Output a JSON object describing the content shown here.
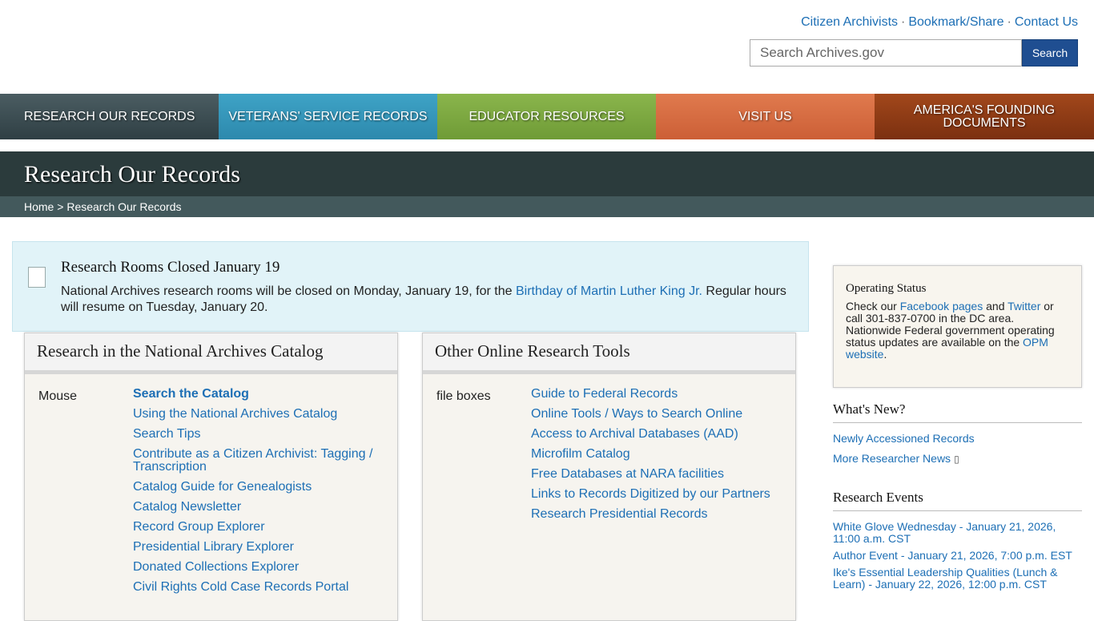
{
  "utility": {
    "citizen": "Citizen Archivists",
    "bookmark": "Bookmark/Share",
    "contact": "Contact Us",
    "separator": "·"
  },
  "search": {
    "placeholder": "Search Archives.gov",
    "button": "Search"
  },
  "nav": [
    {
      "label": "RESEARCH OUR RECORDS"
    },
    {
      "label": "VETERANS' SERVICE RECORDS"
    },
    {
      "label": "EDUCATOR RESOURCES"
    },
    {
      "label": "VISIT US"
    },
    {
      "label": "AMERICA'S FOUNDING DOCUMENTS"
    }
  ],
  "page": {
    "title": "Research Our Records",
    "breadcrumb_home": "Home",
    "breadcrumb_sep": ">",
    "breadcrumb_current": "Research Our Records"
  },
  "alert": {
    "title": "Research Rooms Closed January 19",
    "text_before": "National Archives research rooms will be closed on Monday, January 19, for the ",
    "link": "Birthday of Martin Luther King Jr.",
    "text_after": " Regular hours will resume on Tuesday, January 20."
  },
  "catalog_panel": {
    "title": "Research in the National Archives Catalog",
    "image_alt": "Mouse",
    "links": [
      "Search the Catalog",
      "Using the National Archives Catalog",
      "Search Tips",
      "Contribute as a Citizen Archivist: Tagging / Transcription",
      "Catalog Guide for Genealogists",
      "Catalog Newsletter",
      "Record Group Explorer",
      "Presidential Library Explorer",
      "Donated Collections Explorer",
      "Civil Rights Cold Case Records Portal"
    ]
  },
  "tools_panel": {
    "title": "Other Online Research Tools",
    "image_alt": "file boxes",
    "links": [
      "Guide to Federal Records",
      "Online Tools / Ways to Search Online",
      "Access to Archival Databases (AAD)",
      "Microfilm Catalog",
      "Free Databases at NARA facilities",
      "Links to Records Digitized by our Partners",
      "Research Presidential Records"
    ]
  },
  "sidebar": {
    "operating": {
      "title": "Operating Status",
      "t1": "Check our ",
      "facebook": "Facebook pages",
      "t2": " and ",
      "twitter": "Twitter",
      "t3": " or call 301-837-0700 in the DC area. Nationwide Federal government operating status updates are available on the ",
      "opm": "OPM website",
      "t4": "."
    },
    "whats_new": {
      "title": "What's New?",
      "items": [
        "Newly Accessioned Records",
        "More Researcher News"
      ]
    },
    "events": {
      "title": "Research Events",
      "items": [
        "White Glove Wednesday - January 21, 2026, 11:00 a.m. CST",
        "Author Event - January 21, 2026, 7:00 p.m. EST",
        "Ike's Essential Leadership Qualities (Lunch & Learn) - January 22, 2026, 12:00 p.m. CST"
      ]
    }
  },
  "colors": {
    "link": "#1d6fb5",
    "search_button": "#1f4e91",
    "nav_research": "#3e4f54",
    "nav_veterans": "#3498bd",
    "nav_educator": "#7ea842",
    "nav_visit": "#d96b41",
    "nav_founding": "#8f3c15",
    "page_header": "#2b3b3c",
    "breadcrumb_bar": "#43595c",
    "alert_bg": "#e1f3f8"
  },
  "icons": {
    "more_news": "external-box-icon"
  }
}
